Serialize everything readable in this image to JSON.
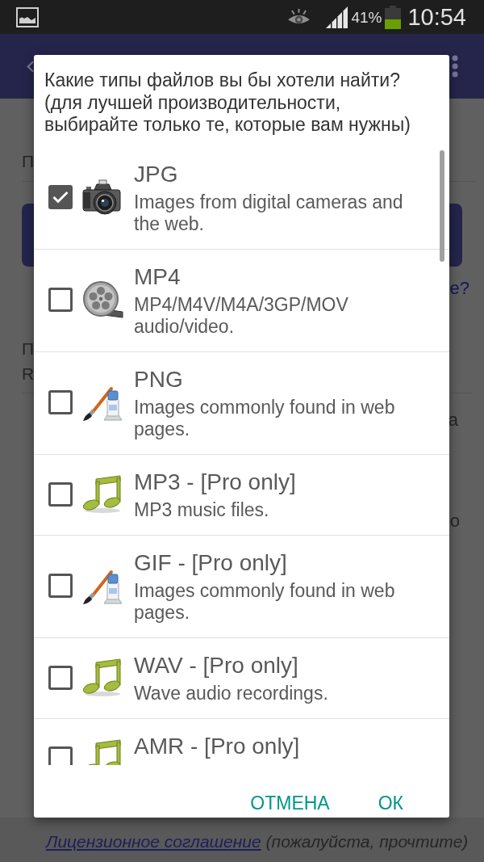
{
  "status_bar": {
    "battery_percent": "41%",
    "time": "10:54"
  },
  "page": {
    "field_label": "П",
    "help_link": "е?",
    "heading_lines": [
      "П",
      "R"
    ],
    "paragraph_1_end": "а",
    "paragraph_2_end": "о",
    "footer": {
      "link": "Лицензионное соглашение",
      "note": "(пожалуйста, прочтите)"
    }
  },
  "dialog": {
    "message": "Какие типы файлов вы бы хотели найти? (для лучшей производительности, выбирайте только те, которые вам нужны)",
    "file_types": [
      {
        "name": "JPG",
        "description": "Images from digital cameras and the web.",
        "checked": true,
        "kind": "photo"
      },
      {
        "name": "MP4",
        "description": "MP4/M4V/M4A/3GP/MOV audio/video.",
        "checked": false,
        "kind": "video"
      },
      {
        "name": "PNG",
        "description": "Images commonly found in web pages.",
        "checked": false,
        "kind": "image"
      },
      {
        "name": "MP3 - [Pro only]",
        "description": "MP3 music files.",
        "checked": false,
        "kind": "audio"
      },
      {
        "name": "GIF - [Pro only]",
        "description": "Images commonly found in web pages.",
        "checked": false,
        "kind": "image"
      },
      {
        "name": "WAV - [Pro only]",
        "description": "Wave audio recordings.",
        "checked": false,
        "kind": "audio"
      },
      {
        "name": "AMR - [Pro only]",
        "checked": false,
        "kind": "audio"
      }
    ],
    "buttons": [
      "ОТМЕНА",
      "ОК"
    ]
  }
}
